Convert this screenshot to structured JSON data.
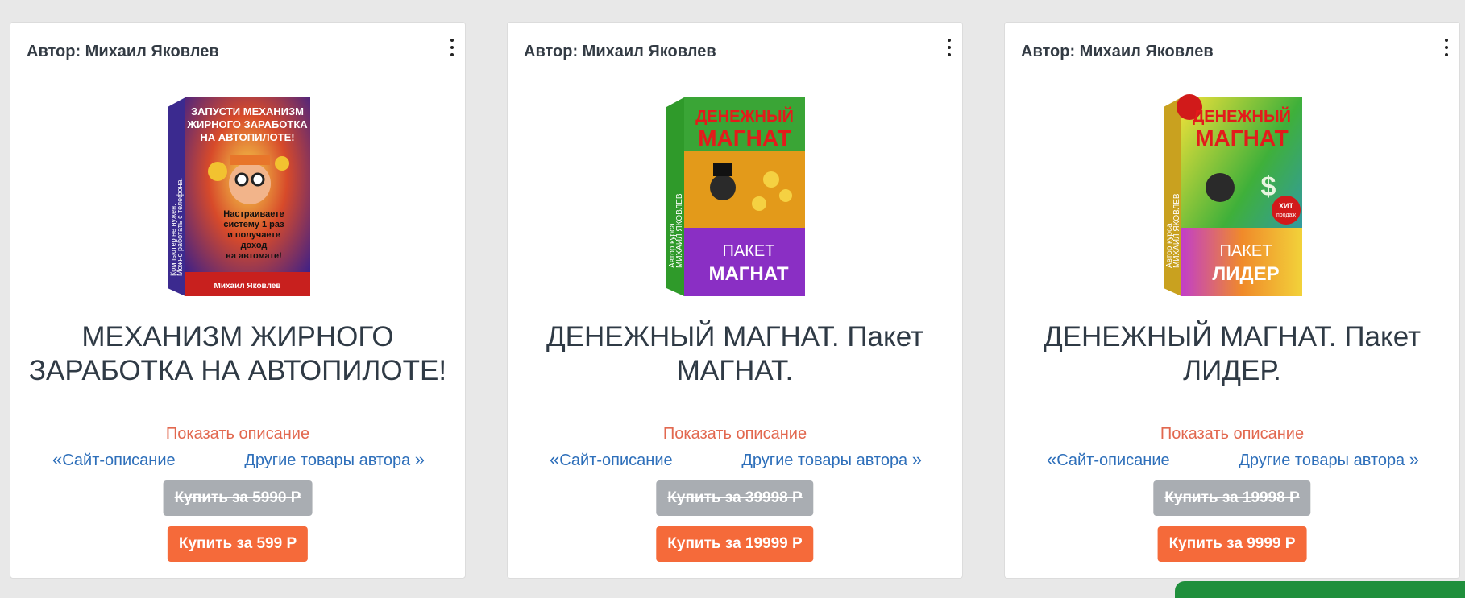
{
  "cards": [
    {
      "author": "Автор: Михаил Яковлев",
      "title": "МЕХАНИЗМ ЖИРНОГО ЗАРАБОТКА НА АВТОПИЛОТЕ!",
      "show_description": "Показать описание",
      "site_link": "Сайт-описание",
      "other_link": "Другие товары автора",
      "old_price_button": "Купить за 5990 Р",
      "buy_button": "Купить за 599 Р",
      "cover": {
        "top_text": [
          "ЗАПУСТИ МЕХАНИЗМ",
          "ЖИРНОГО ЗАРАБОТКА",
          "НА АВТОПИЛОТЕ!"
        ],
        "side_text": [
          "Компьютер не нужен.",
          "Можно работать с телефона."
        ],
        "middle_text": [
          "Настраиваете",
          "систему 1 раз",
          "и получаете",
          "доход",
          "на автомате!"
        ],
        "bottom_text": "Михаил Яковлев"
      }
    },
    {
      "author": "Автор: Михаил Яковлев",
      "title": "ДЕНЕЖНЫЙ МАГНАТ. Пакет МАГНАТ.",
      "show_description": "Показать описание",
      "site_link": "Сайт-описание",
      "other_link": "Другие товары автора",
      "old_price_button": "Купить за 39998 Р",
      "buy_button": "Купить за 19999 Р",
      "cover": {
        "top_text": [
          "ДЕНЕЖНЫЙ",
          "МАГНАТ"
        ],
        "side_text": [
          "Автор курса",
          "МИХАИЛ ЯКОВЛЕВ"
        ],
        "package_text": [
          "ПАКЕТ",
          "МАГНАТ"
        ]
      }
    },
    {
      "author": "Автор: Михаил Яковлев",
      "title": "ДЕНЕЖНЫЙ МАГНАТ. Пакет ЛИДЕР.",
      "show_description": "Показать описание",
      "site_link": "Сайт-описание",
      "other_link": "Другие товары автора",
      "old_price_button": "Купить за 19998 Р",
      "buy_button": "Купить за 9999 Р",
      "cover": {
        "top_text": [
          "ДЕНЕЖНЫЙ",
          "МАГНАТ"
        ],
        "side_text": [
          "Автор курса",
          "МИХАИЛ ЯКОВЛЕВ"
        ],
        "package_text": [
          "ПАКЕТ",
          "ЛИДЕР"
        ],
        "badge": [
          "ХИТ",
          "продаж"
        ]
      }
    }
  ],
  "icons": {
    "menu": "kebab-menu-icon",
    "left": "double-chevron-left-icon",
    "right": "double-chevron-right-icon"
  },
  "colors": {
    "page_bg": "#e8e8e8",
    "show_description": "#e2684f",
    "link": "#2e6fba",
    "old_price_bg": "#a9adb2",
    "buy_bg": "#f56a3a",
    "corner_widget": "#1f8f3c"
  }
}
